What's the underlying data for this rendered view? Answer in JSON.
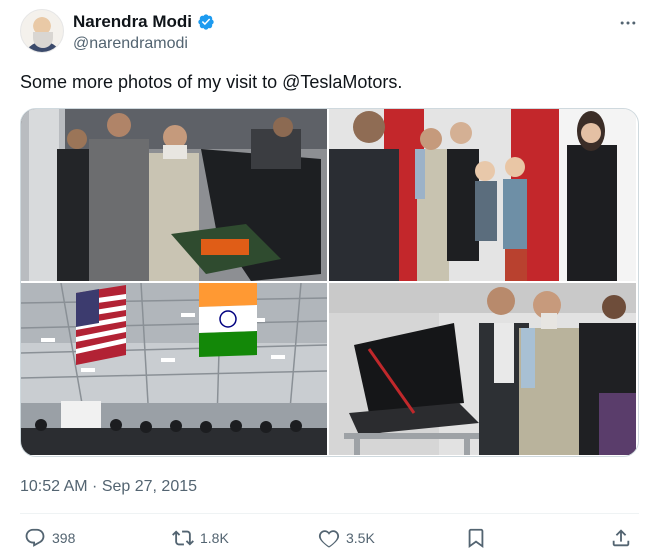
{
  "author": {
    "display_name": "Narendra Modi",
    "handle": "@narendramodi",
    "verified": true
  },
  "tweet": {
    "text": "Some more photos of my visit to @TeslaMotors.",
    "timestamp": "10:52 AM · Sep 27, 2015"
  },
  "stats": {
    "replies": "398",
    "retweets": "1.8K",
    "likes": "3.5K"
  },
  "colors": {
    "text": "#0f1419",
    "secondary": "#536471",
    "verified": "#1d9bf0",
    "border": "#cfd9de"
  },
  "icons": {
    "more": "more-horizontal-icon",
    "verified": "verified-badge-icon",
    "reply": "reply-icon",
    "retweet": "retweet-icon",
    "like": "heart-icon",
    "bookmark": "bookmark-icon",
    "share": "share-icon"
  }
}
